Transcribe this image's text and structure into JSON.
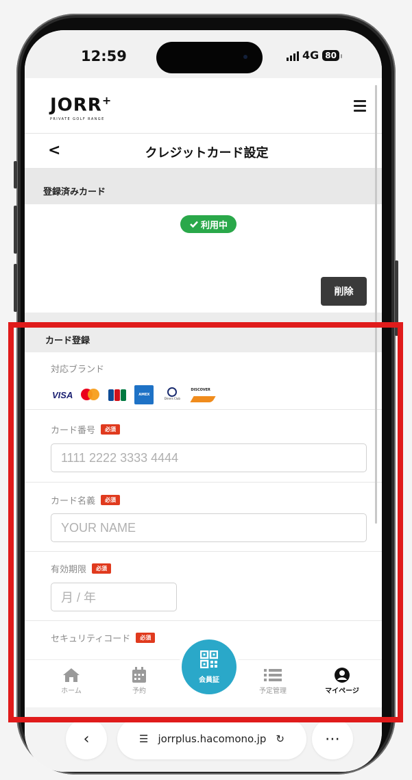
{
  "status_bar": {
    "time": "12:59",
    "network": "4G",
    "battery": "80"
  },
  "header": {
    "logo_text": "JORR",
    "logo_plus": "+",
    "logo_subtitle": "PRIVATE GOLF RANGE"
  },
  "nav": {
    "back": "<",
    "title": "クレジットカード設定"
  },
  "registered": {
    "heading": "登録済みカード",
    "status_badge": "利用中",
    "delete_label": "削除"
  },
  "card_form": {
    "heading": "カード登録",
    "brands_label": "対応ブランド",
    "brands": [
      "VISA",
      "Mastercard",
      "JCB",
      "AMERICAN EXPRESS",
      "Diners Club",
      "DISCOVER"
    ],
    "required_badge": "必須",
    "card_number_label": "カード番号",
    "card_number_placeholder": "1111 2222 3333 4444",
    "card_name_label": "カード名義",
    "card_name_placeholder": "YOUR NAME",
    "expiry_label": "有効期限",
    "expiry_placeholder": "月 / 年",
    "security_label": "セキュリティコード"
  },
  "tabbar": {
    "home": "ホーム",
    "reserve": "予約",
    "member_card": "会員証",
    "schedule": "予定管理",
    "mypage": "マイページ"
  },
  "browser": {
    "url": "jorrplus.hacomono.jp"
  },
  "colors": {
    "accent_teal": "#2aa8c9",
    "success_green": "#2aa84a",
    "required_red": "#e03a1e",
    "highlight_red": "#e01b1b"
  }
}
